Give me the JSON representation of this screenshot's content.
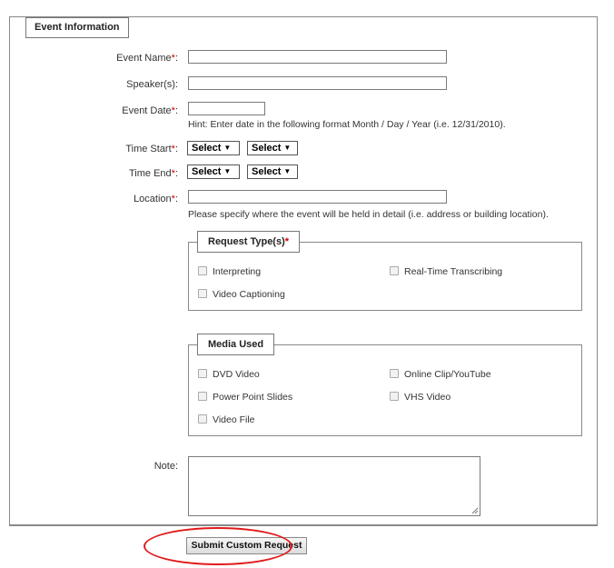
{
  "form": {
    "legend": "Event Information",
    "required_mark": "*",
    "fields": {
      "event_name": {
        "label": "Event Name",
        "required": true,
        "value": ""
      },
      "speakers": {
        "label": "Speaker(s):",
        "value": ""
      },
      "event_date": {
        "label": "Event Date",
        "value": "",
        "hint": "Hint: Enter date in the following format Month / Day / Year (i.e. 12/31/2010)."
      },
      "time_start": {
        "label": "Time Start",
        "hour": "Select",
        "minute": "Select"
      },
      "time_end": {
        "label": "Time End",
        "hour": "Select",
        "minute": "Select"
      },
      "location": {
        "label": "Location",
        "value": "",
        "hint": "Please specify where the event will be held in detail (i.e. address or building location)."
      },
      "note": {
        "label": "Note:",
        "value": ""
      }
    },
    "colon": ":",
    "request_types": {
      "legend": "Request Type(s)",
      "options": [
        "Interpreting",
        "Real-Time Transcribing",
        "Video Captioning"
      ]
    },
    "media_used": {
      "legend": "Media Used",
      "options": [
        "DVD Video",
        "Online Clip/YouTube",
        "Power Point Slides",
        "VHS Video",
        "Video File"
      ]
    },
    "submit_label": "Submit Custom Request"
  },
  "colors": {
    "required": "#cc0000",
    "highlight_ring": "#e01b1b"
  }
}
